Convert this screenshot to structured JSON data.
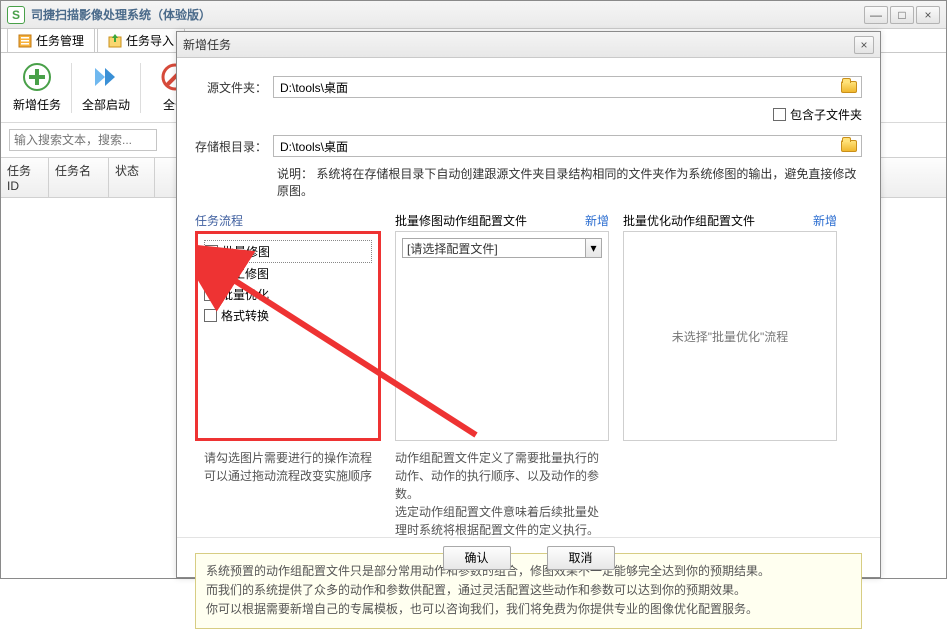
{
  "window": {
    "title": "司捷扫描影像处理系统（体验版）"
  },
  "tabs": {
    "task_mgr": "任务管理",
    "task_import": "任务导入"
  },
  "toolbar": {
    "new_task": "新增任务",
    "start_all": "全部启动",
    "stop_all": "全部"
  },
  "search": {
    "placeholder": "输入搜索文本，搜索..."
  },
  "grid": {
    "col_task_id": "任务ID",
    "col_task_name": "任务名",
    "col_status": "状态"
  },
  "dialog": {
    "title": "新增任务",
    "src_folder_label": "源文件夹：",
    "src_folder_value": "D:\\tools\\桌面",
    "include_sub": "包含子文件夹",
    "store_root_label": "存储根目录：",
    "store_root_value": "D:\\tools\\桌面",
    "note_label": "说明：",
    "note_text": "系统将在存储根目录下自动创建跟源文件夹目录结构相同的文件夹作为系统修图的输出，避免直接修改原图。",
    "taskflow": {
      "label": "任务流程",
      "items": [
        {
          "label": "批量修图",
          "checked": true
        },
        {
          "label": "人工修图",
          "checked": true
        },
        {
          "label": "批量优化",
          "checked": false
        },
        {
          "label": "格式转换",
          "checked": false
        }
      ],
      "desc1": "请勾选图片需要进行的操作流程",
      "desc2": "可以通过拖动流程改变实施顺序"
    },
    "config_b": {
      "label": "批量修图动作组配置文件",
      "new": "新增",
      "combo_text": "[请选择配置文件]",
      "desc1": "动作组配置文件定义了需要批量执行的动作、动作的执行顺序、以及动作的参数。",
      "desc2": "选定动作组配置文件意味着后续批量处理时系统将根据配置文件的定义执行。"
    },
    "config_c": {
      "label": "批量优化动作组配置文件",
      "new": "新增",
      "empty_text": "未选择\"批量优化\"流程"
    },
    "yellow": {
      "l1": "系统预置的动作组配置文件只是部分常用动作和参数的组合，修图效果不一定能够完全达到你的预期结果。",
      "l2": "而我们的系统提供了众多的动作和参数供配置，通过灵活配置这些动作和参数可以达到你的预期效果。",
      "l3": "你可以根据需要新增自己的专属模板，也可以咨询我们，我们将免费为你提供专业的图像优化配置服务。"
    },
    "ok": "确认",
    "cancel": "取消"
  }
}
